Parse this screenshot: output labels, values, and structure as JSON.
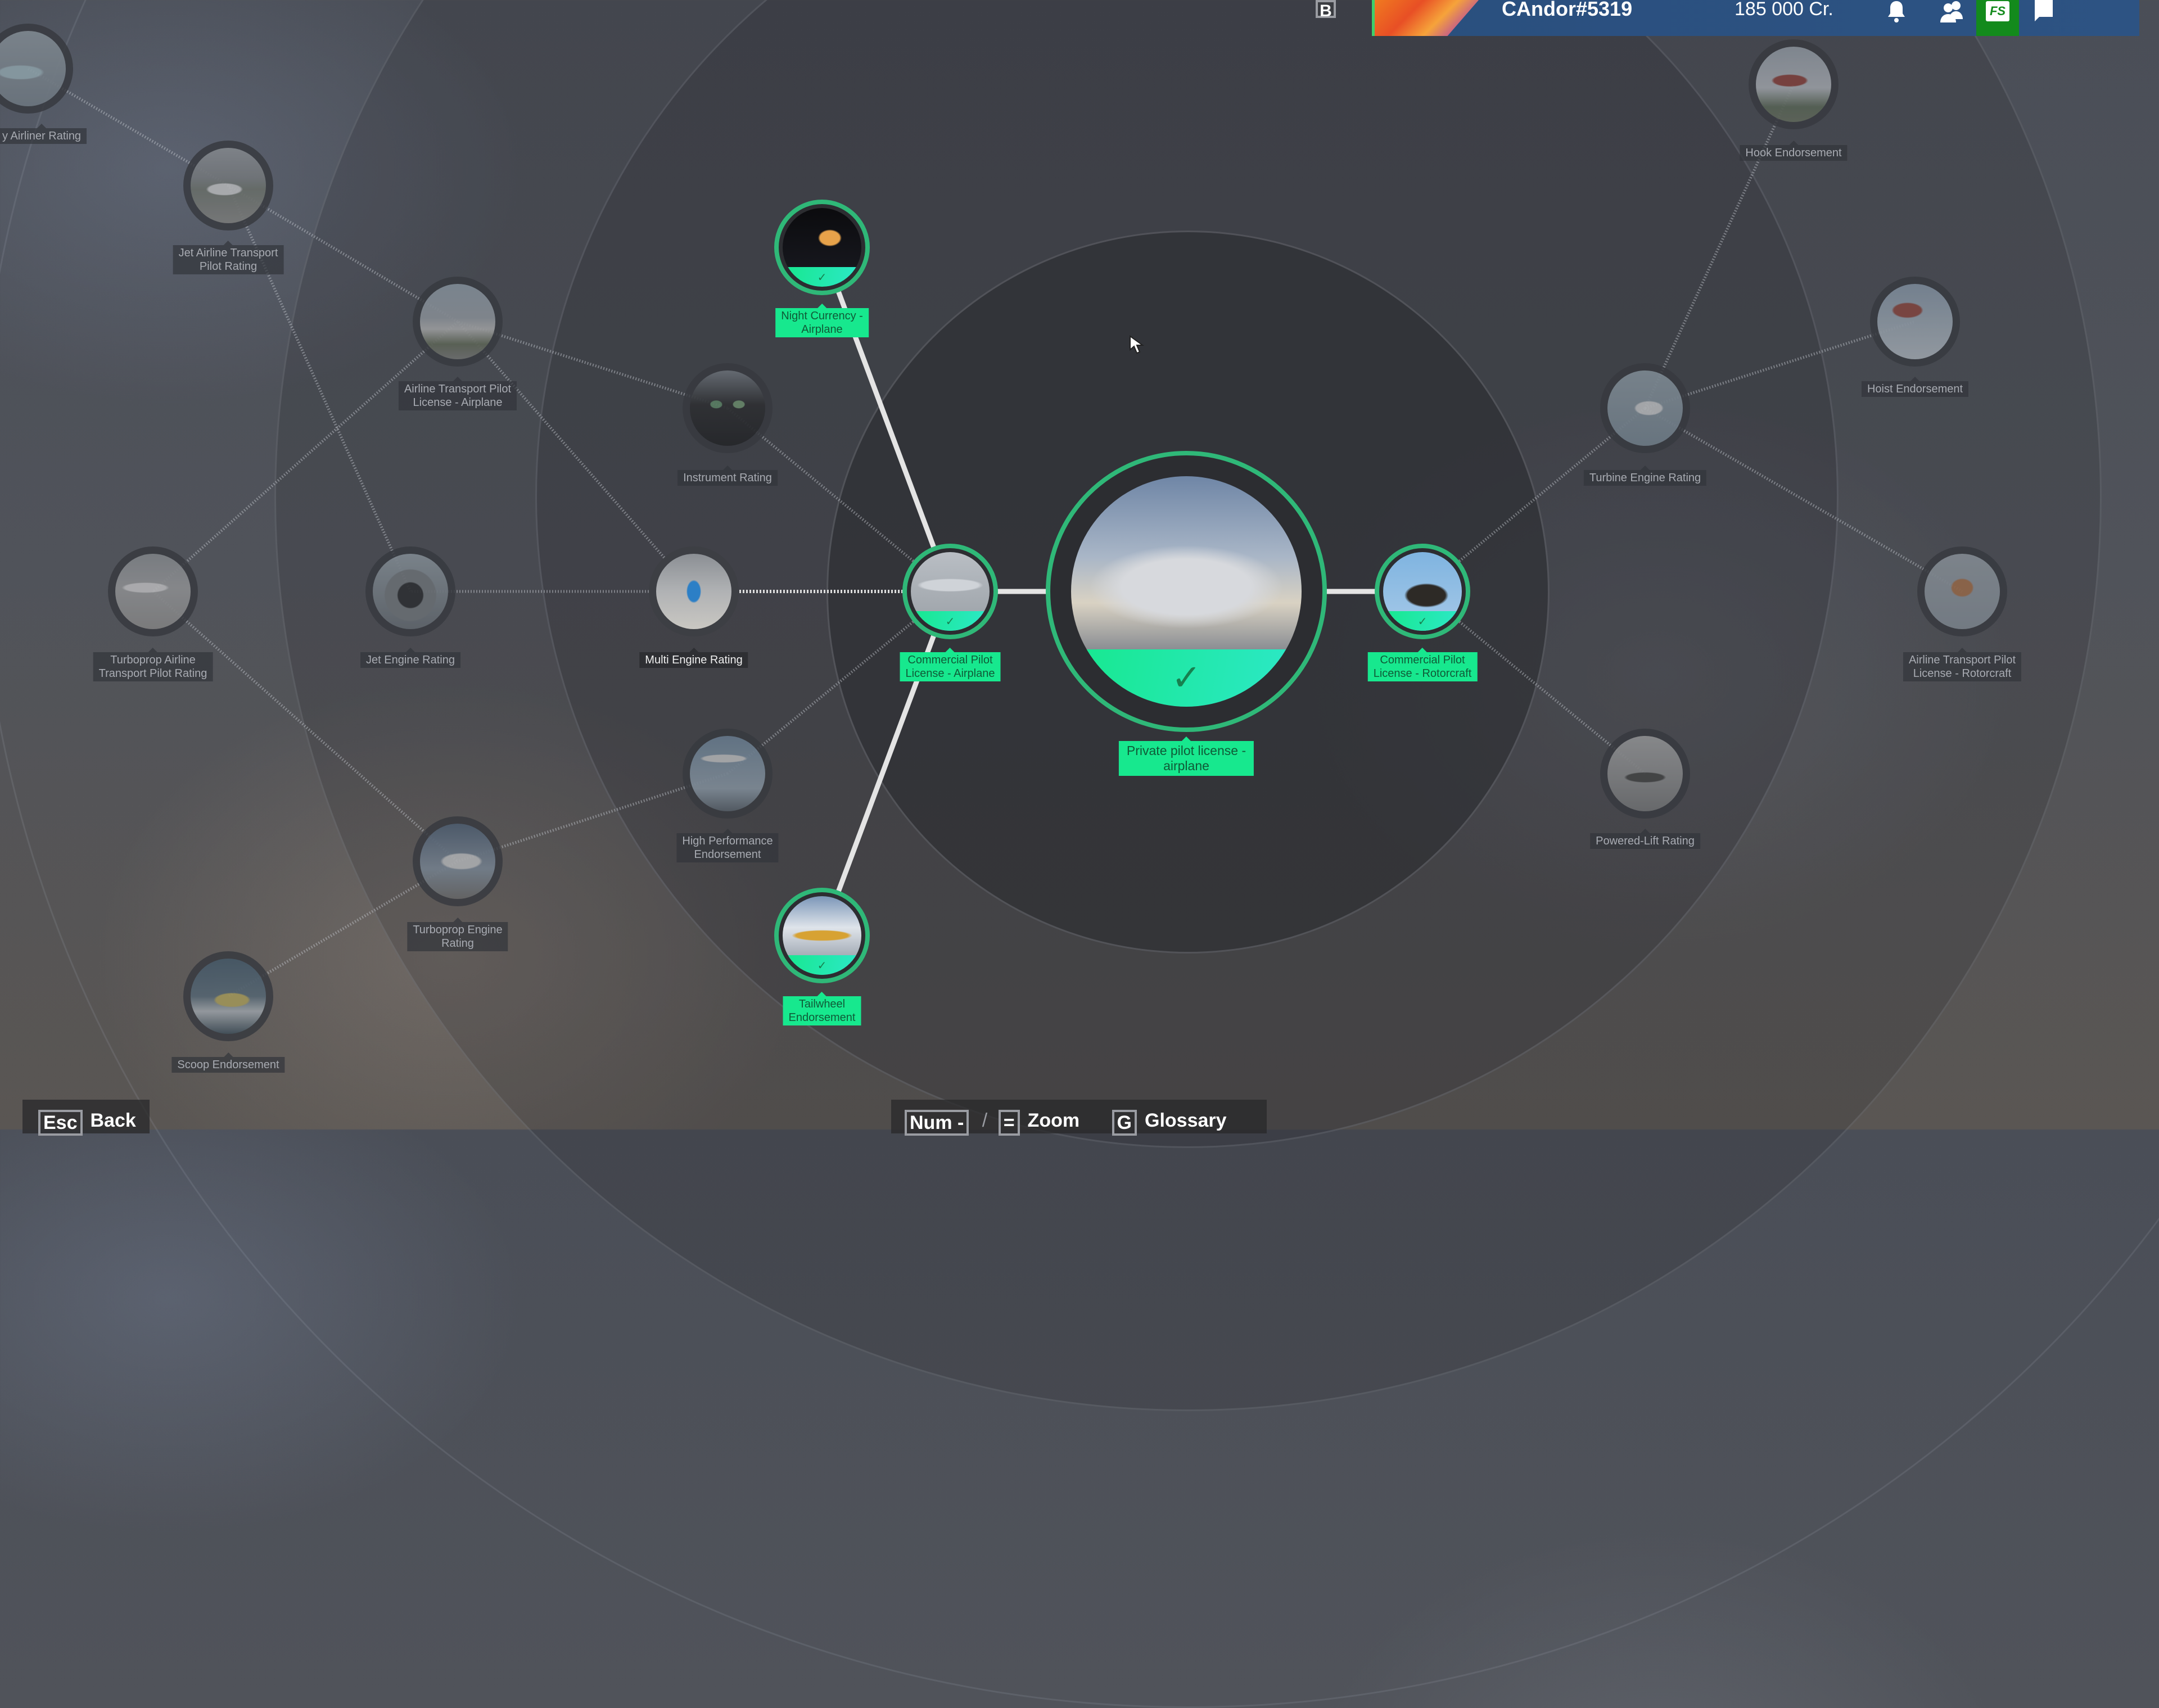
{
  "topbar": {
    "username": "CAndor#5319",
    "credits": "185 000 Cr.",
    "keybind_b": "B",
    "store_label": "FS",
    "icons": [
      "bell-icon",
      "friends-icon",
      "gear-icon",
      "store-icon",
      "chat-icon"
    ]
  },
  "bottom": {
    "back_key": "Esc",
    "back_label": "Back",
    "zoom_key_minus": "Num -",
    "zoom_separator": "/",
    "zoom_key_plus": "=",
    "zoom_label": "Zoom",
    "glossary_key": "G",
    "glossary_label": "Glossary"
  },
  "colors": {
    "completed": "#17e88e",
    "completed_ring": "#2fb878",
    "topbar": "#2a4f7e",
    "store": "#138a1c"
  },
  "tree": {
    "nodes": [
      {
        "id": "ppl",
        "lines": [
          "Private pilot license -",
          "airplane"
        ],
        "status": "completed",
        "img": "cessna-clouds"
      },
      {
        "id": "cpl-a",
        "lines": [
          "Commercial Pilot",
          "License - Airplane"
        ],
        "status": "completed",
        "img": "highwing-plane"
      },
      {
        "id": "cpl-r",
        "lines": [
          "Commercial Pilot",
          "License - Rotorcraft"
        ],
        "status": "completed",
        "img": "helicopter"
      },
      {
        "id": "night",
        "lines": [
          "Night Currency -",
          "Airplane"
        ],
        "status": "completed",
        "img": "night-cockpit"
      },
      {
        "id": "tailwheel",
        "lines": [
          "Tailwheel",
          "Endorsement"
        ],
        "status": "completed",
        "img": "yellow-tailwheel"
      },
      {
        "id": "multi",
        "lines": [
          "Multi Engine Rating"
        ],
        "status": "available",
        "img": "twin-engine"
      },
      {
        "id": "instrument",
        "lines": [
          "Instrument Rating"
        ],
        "status": "locked",
        "img": "glass-cockpit"
      },
      {
        "id": "highperf",
        "lines": [
          "High Performance",
          "Endorsement"
        ],
        "status": "locked",
        "img": "bizjet"
      },
      {
        "id": "atpl-a",
        "lines": [
          "Airline Transport Pilot",
          "License - Airplane"
        ],
        "status": "locked",
        "img": "cirrus-city"
      },
      {
        "id": "jetengine",
        "lines": [
          "Jet Engine Rating"
        ],
        "status": "locked",
        "img": "jet-engine"
      },
      {
        "id": "turboprop",
        "lines": [
          "Turboprop Engine",
          "Rating"
        ],
        "status": "locked",
        "img": "turboprop"
      },
      {
        "id": "jetatp",
        "lines": [
          "Jet Airline Transport",
          "Pilot Rating"
        ],
        "status": "locked",
        "img": "airliner-ramp"
      },
      {
        "id": "tpatp",
        "lines": [
          "Turboprop Airline",
          "Transport Pilot Rating"
        ],
        "status": "locked",
        "img": "atr-ramp"
      },
      {
        "id": "heavy",
        "lines": [
          "y Airliner Rating"
        ],
        "status": "locked",
        "img": "beluga"
      },
      {
        "id": "scoop",
        "lines": [
          "Scoop Endorsement"
        ],
        "status": "locked",
        "img": "water-bomber"
      },
      {
        "id": "turbine",
        "lines": [
          "Turbine Engine Rating"
        ],
        "status": "locked",
        "img": "ecureuil"
      },
      {
        "id": "hook",
        "lines": [
          "Hook Endorsement"
        ],
        "status": "locked",
        "img": "red-heli"
      },
      {
        "id": "hoist",
        "lines": [
          "Hoist Endorsement"
        ],
        "status": "locked",
        "img": "rescue-heli"
      },
      {
        "id": "atpl-r",
        "lines": [
          "Airline Transport Pilot",
          "License - Rotorcraft"
        ],
        "status": "locked",
        "img": "skycrane"
      },
      {
        "id": "poweredlift",
        "lines": [
          "Powered-Lift Rating"
        ],
        "status": "locked",
        "img": "evtol"
      }
    ],
    "links": [
      {
        "from": "ppl",
        "to": "cpl-a",
        "type": "solid"
      },
      {
        "from": "ppl",
        "to": "cpl-r",
        "type": "solid"
      },
      {
        "from": "cpl-a",
        "to": "night",
        "type": "solid"
      },
      {
        "from": "cpl-a",
        "to": "tailwheel",
        "type": "solid"
      },
      {
        "from": "cpl-a",
        "to": "multi",
        "type": "dotted-bright"
      },
      {
        "from": "cpl-a",
        "to": "instrument",
        "type": "dotted"
      },
      {
        "from": "cpl-a",
        "to": "highperf",
        "type": "dotted"
      },
      {
        "from": "instrument",
        "to": "atpl-a",
        "type": "dotted"
      },
      {
        "from": "multi",
        "to": "atpl-a",
        "type": "dotted"
      },
      {
        "from": "atpl-a",
        "to": "jetatp",
        "type": "dotted"
      },
      {
        "from": "atpl-a",
        "to": "tpatp",
        "type": "dotted"
      },
      {
        "from": "jetatp",
        "to": "heavy",
        "type": "dotted"
      },
      {
        "from": "jetatp",
        "to": "jetengine",
        "type": "dotted"
      },
      {
        "from": "multi",
        "to": "jetengine",
        "type": "dotted"
      },
      {
        "from": "highperf",
        "to": "turboprop",
        "type": "dotted"
      },
      {
        "from": "tpatp",
        "to": "turboprop",
        "type": "dotted"
      },
      {
        "from": "turboprop",
        "to": "scoop",
        "type": "dotted"
      },
      {
        "from": "cpl-r",
        "to": "turbine",
        "type": "dotted"
      },
      {
        "from": "cpl-r",
        "to": "poweredlift",
        "type": "dotted"
      },
      {
        "from": "turbine",
        "to": "hook",
        "type": "dotted"
      },
      {
        "from": "turbine",
        "to": "hoist",
        "type": "dotted"
      },
      {
        "from": "turbine",
        "to": "atpl-r",
        "type": "dotted"
      }
    ]
  }
}
